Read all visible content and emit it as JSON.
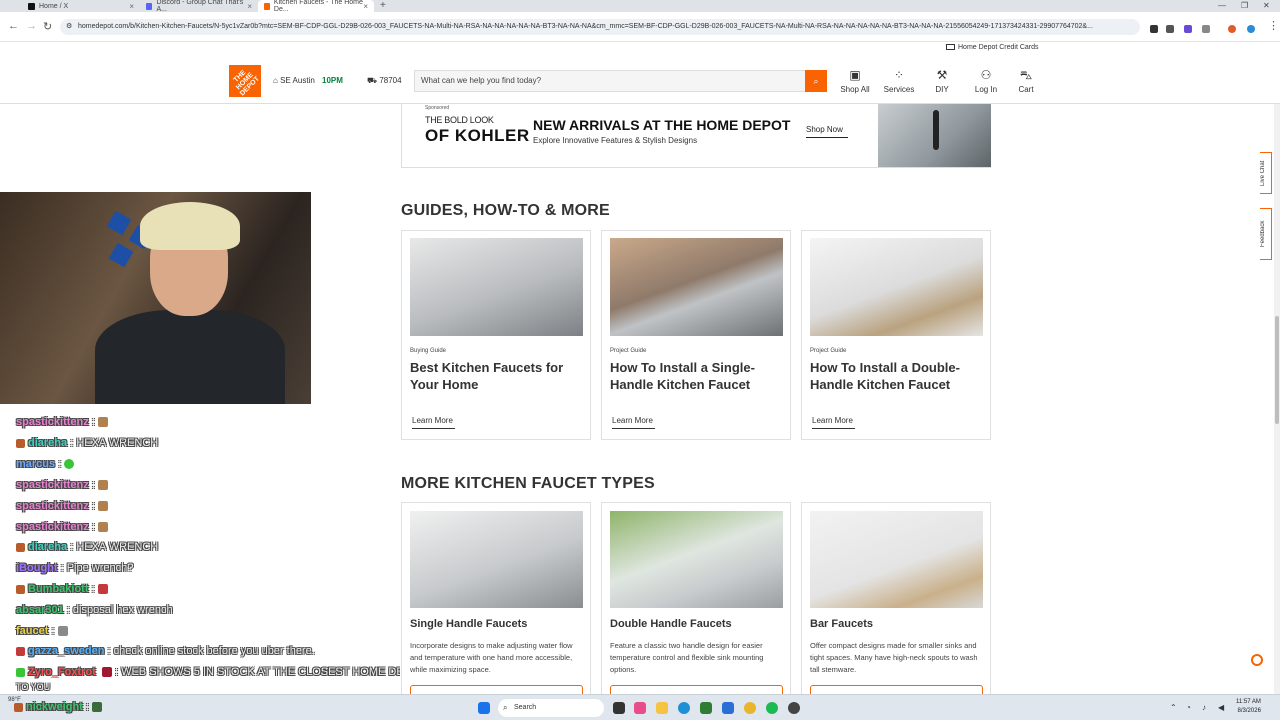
{
  "browser": {
    "tabs": [
      {
        "title": "Home / X",
        "color": "#111111"
      },
      {
        "title": "Discord - Group Chat That's A...",
        "color": "#5865f2"
      },
      {
        "title": "Kitchen Faucets - The Home De...",
        "color": "#f96302"
      }
    ],
    "url": "homedepot.com/b/Kitchen-Kitchen-Faucets/N-5yc1vZar0b?mtc=SEM-BF-CDP-GGL-D29B-026-003_FAUCETS-NA-Multi-NA-RSA-NA-NA-NA-NA-NA-BT3-NA-NA-NA&cm_mmc=SEM-BF-CDP-GGL-D29B-026-003_FAUCETS-NA-Multi-NA-RSA-NA-NA-NA-NA-NA-BT3-NA-NA-NA-21556054249-171373424331-29907764702&..."
  },
  "header": {
    "credit_cards": "Home Depot Credit Cards",
    "logo_text": "THE HOME DEPOT",
    "store_name": "SE Austin",
    "store_hours": "10PM",
    "zip": "78704",
    "search_placeholder": "What can we help you find today?",
    "nav": [
      {
        "label": "Shop All",
        "icon": "shop-all-icon"
      },
      {
        "label": "Services",
        "icon": "services-icon"
      },
      {
        "label": "DIY",
        "icon": "diy-icon"
      },
      {
        "label": "Log In",
        "icon": "user-icon"
      },
      {
        "label": "Cart",
        "icon": "cart-icon"
      }
    ]
  },
  "banner": {
    "sponsored": "Sponsored",
    "brand_line1": "THE BOLD LOOK",
    "brand_line2": "OF KOHLER",
    "headline": "NEW ARRIVALS AT THE HOME DEPOT",
    "subline": "Explore Innovative Features & Stylish Designs",
    "cta": "Shop Now"
  },
  "guides": {
    "title": "GUIDES, HOW-TO & MORE",
    "cards": [
      {
        "category": "Buying Guide",
        "title": "Best Kitchen Faucets for Your Home",
        "cta": "Learn More"
      },
      {
        "category": "Project Guide",
        "title": "How To Install a Single-Handle Kitchen Faucet",
        "cta": "Learn More"
      },
      {
        "category": "Project Guide",
        "title": "How To Install a Double-Handle Kitchen Faucet",
        "cta": "Learn More"
      }
    ]
  },
  "types": {
    "title": "MORE KITCHEN FAUCET TYPES",
    "cards": [
      {
        "title": "Single Handle Faucets",
        "desc": "Incorporate designs to make adjusting water flow and temperature with one hand more accessible, while maximizing space."
      },
      {
        "title": "Double Handle Faucets",
        "desc": "Feature a classic two handle design for easier temperature control and flexible sink mounting options."
      },
      {
        "title": "Bar Faucets",
        "desc": "Offer compact designs made for smaller sinks and tight spaces. Many have high-neck spouts to wash tall stemware."
      }
    ]
  },
  "sidebar_tabs": {
    "live_chat": "Live Chat",
    "feedback": "Feedback"
  },
  "chat": [
    {
      "user": "spastickittenz",
      "color": "#e77fd0",
      "text": ":"
    },
    {
      "user": "diareha",
      "color": "#38d3c4",
      "text": ": HEXA WRENCH"
    },
    {
      "user": "marcus",
      "color": "#6aa8ff",
      "text": ":"
    },
    {
      "user": "spastickittenz",
      "color": "#e77fd0",
      "text": ":"
    },
    {
      "user": "spastickittenz",
      "color": "#e77fd0",
      "text": ":"
    },
    {
      "user": "spastickittenz",
      "color": "#e77fd0",
      "text": ":"
    },
    {
      "user": "diareha",
      "color": "#38d3c4",
      "text": ": HEXA WRENCH"
    },
    {
      "user": "iBought",
      "color": "#a070ff",
      "text": ": Pipe wrench?"
    },
    {
      "user": "Bumbakiott",
      "color": "#3ac46b",
      "text": ":"
    },
    {
      "user": "absar301",
      "color": "#3ac46b",
      "text": ": disposal hex wrench"
    },
    {
      "user": "faucet",
      "color": "#e6d04a",
      "text": ":"
    },
    {
      "user": "gazza_sweden",
      "color": "#4fb0ff",
      "text": ": check online stock before you uber there."
    },
    {
      "user": "Zyro_Foxtrot",
      "color": "#ff4a4a",
      "text": ": WEB SHOWS 5 IN STOCK AT THE CLOSEST HOME DEPOT"
    },
    {
      "user": "",
      "color": "#eeeeee",
      "text": "TO YOU"
    },
    {
      "user": "nickweight",
      "color": "#3ac46b",
      "text": ":"
    }
  ],
  "taskbar": {
    "search": "Search",
    "time": "11:57 AM",
    "date": "8/3/2026",
    "weather": "98°F"
  }
}
